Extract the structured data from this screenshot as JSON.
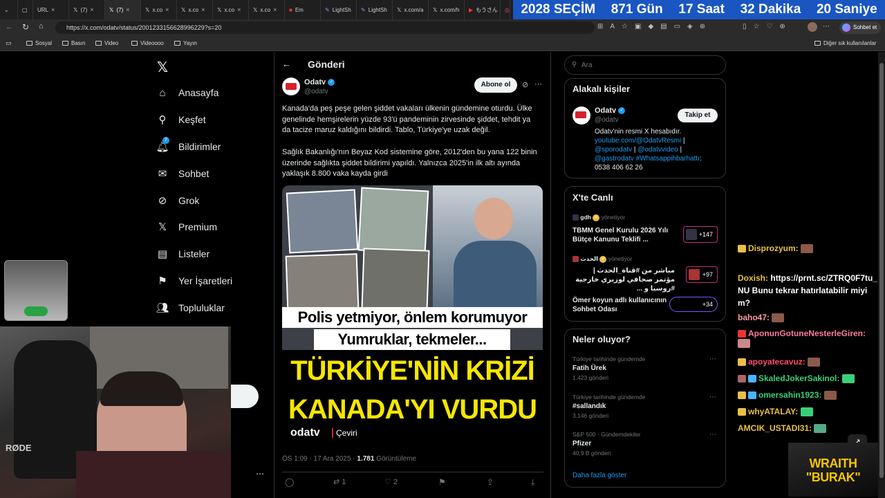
{
  "browser": {
    "tabs": [
      "URL",
      "(7)",
      "(7)",
      "x.co",
      "x.co",
      "x.co",
      "x.co",
      "Em",
      "LightSh",
      "LightSh",
      "x.com/a",
      "x.com/h",
      "もうさん"
    ],
    "url": "https://x.com/odatv/status/2001233156628996229?s=20",
    "copilot_label": "Sohbet et",
    "bookmarks": [
      "Sosyal",
      "Basın",
      "Video",
      "Videoooo",
      "Yayın"
    ],
    "other_bookmarks": "Diğer sık kullanılanlar"
  },
  "countdown": {
    "label": "2028 SEÇİM",
    "days": "871 Gün",
    "hours": "17 Saat",
    "minutes": "32 Dakika",
    "seconds": "20 Saniye"
  },
  "sidebar": {
    "items": [
      {
        "label": "Anasayfa",
        "icon": "home-icon"
      },
      {
        "label": "Keşfet",
        "icon": "search-icon"
      },
      {
        "label": "Bildirimler",
        "icon": "bell-icon"
      },
      {
        "label": "Sohbet",
        "icon": "mail-icon"
      },
      {
        "label": "Grok",
        "icon": "grok-icon"
      },
      {
        "label": "Premium",
        "icon": "x-logo-icon"
      },
      {
        "label": "Listeler",
        "icon": "list-icon"
      },
      {
        "label": "Yer İşaretleri",
        "icon": "bookmark-icon"
      },
      {
        "label": "Topluluklar",
        "icon": "people-icon"
      }
    ],
    "notif_count": "7"
  },
  "post": {
    "header_title": "Gönderi",
    "author_name": "Odatv",
    "author_handle": "@odatv",
    "subscribe_label": "Abone ol",
    "text_p1": "Kanada'da peş peşe gelen şiddet vakaları ülkenin gündemine oturdu. Ülke genelinde hemşirelerin yüzde 93'ü pandeminin zirvesinde şiddet, tehdit ya da tacize maruz kaldığını bildirdi. Tablo, Türkiye'ye uzak değil.",
    "text_p2": "Sağlık Bakanlığı'nın Beyaz Kod sistemine göre, 2012'den bu yana 122 binin üzerinde sağlıkta şiddet bildirimi yapıldı. Yalnızca 2025'in ilk altı ayında yaklaşık 8.800 vaka kayda girdi",
    "image_line1": "Polis yetmiyor, önlem korumuyor",
    "image_line2": "Yumruklar, tekmeler...",
    "image_headline1": "TÜRKİYE'NİN KRİZİ",
    "image_headline2": "KANADA'YI VURDU",
    "image_brand": "odatv",
    "image_tag": "Çeviri",
    "time": "ÖS 1:09 · 17 Ara 2025 ·",
    "views_count": "1.781",
    "views_label": "Görüntüleme",
    "retweets": "1",
    "likes": "2"
  },
  "right": {
    "search_placeholder": "Ara",
    "related_title": "Alakalı kişiler",
    "related_name": "Odatv",
    "related_handle": "@odatv",
    "follow_label": "Takip et",
    "bio_line1": "Odatv'nin resmi X hesabıdır.",
    "bio_link1": "youtube.com/@OdatvResmi",
    "bio_sep1": " |",
    "bio_link2": "@sporodatv",
    "bio_sep2": " | ",
    "bio_link3": "@odatvvideo",
    "bio_sep3": " |",
    "bio_link4": "@gastrodatv",
    "bio_link5": " #Whatsappihbarhattı",
    "bio_sep4": ":",
    "bio_phone": "0538 406 62 26",
    "live_title": "X'te Canlı",
    "live": [
      {
        "host": "gdh",
        "status": "yönetiyor",
        "title": "TBMM Genel Kurulu 2026 Yılı Bütçe Kanunu Teklifi ...",
        "count": "+147"
      },
      {
        "host": "الحدث",
        "status": "yönetiyor",
        "title": "مباشر من #قناة_الحدث | مؤتمر صحافي لوزيري خارجية #روسيا و ...",
        "count": "+97"
      },
      {
        "host": "",
        "status": "",
        "title": "Ömer koyun adlı kullanıcının Sohbet Odası",
        "count": "+34"
      }
    ],
    "trends_title": "Neler oluyor?",
    "trends": [
      {
        "context": "Türkiye tarihinde gündemde",
        "title": "Fatih Ürek",
        "posts": "1.423 gönderi"
      },
      {
        "context": "Türkiye tarihinde gündemde",
        "title": "#sallandık",
        "posts": "3.146 gönderi"
      },
      {
        "context": "S&P 500 · Gündemdekiler",
        "title": "Pfizer",
        "posts": "40,9 B gönderi"
      }
    ],
    "show_more": "Daha fazla göster"
  },
  "chat": [
    {
      "user": "Disprozyum:",
      "msg": "",
      "color": "#e8c048"
    },
    {
      "user": "Doxish:",
      "msg": "https://prnt.sc/ZTRQ0F7tu_NU Bunu tekrar hatırlatabilir miyim?",
      "color": "#e8c048"
    },
    {
      "user": "baho47:",
      "msg": "",
      "color": "#ff9aa2"
    },
    {
      "user": "AponunGotuneNesterleGiren:",
      "msg": "",
      "color": "#ff7b9c"
    },
    {
      "user": "apoyatecavuz:",
      "msg": "",
      "color": "#ff4d6d"
    },
    {
      "user": "SkaledJokerSakinol:",
      "msg": "",
      "color": "#3ad07a"
    },
    {
      "user": "omersahin1923:",
      "msg": "",
      "color": "#3ad07a"
    },
    {
      "user": "whyATALAY:",
      "msg": "",
      "color": "#e8c048"
    },
    {
      "user": "AMCIK_USTADI31:",
      "msg": "",
      "color": "#e8c048"
    }
  ],
  "overlay": {
    "brand_line1": "WRAITH",
    "brand_line2": "\"BURAK\"",
    "mic_brand": "RØDE"
  },
  "colors": {
    "x_blue": "#1d9bf0",
    "countdown_bg": "#1a56c2",
    "brand_orange": "#f5c400",
    "odatv_red": "#d6202e"
  }
}
